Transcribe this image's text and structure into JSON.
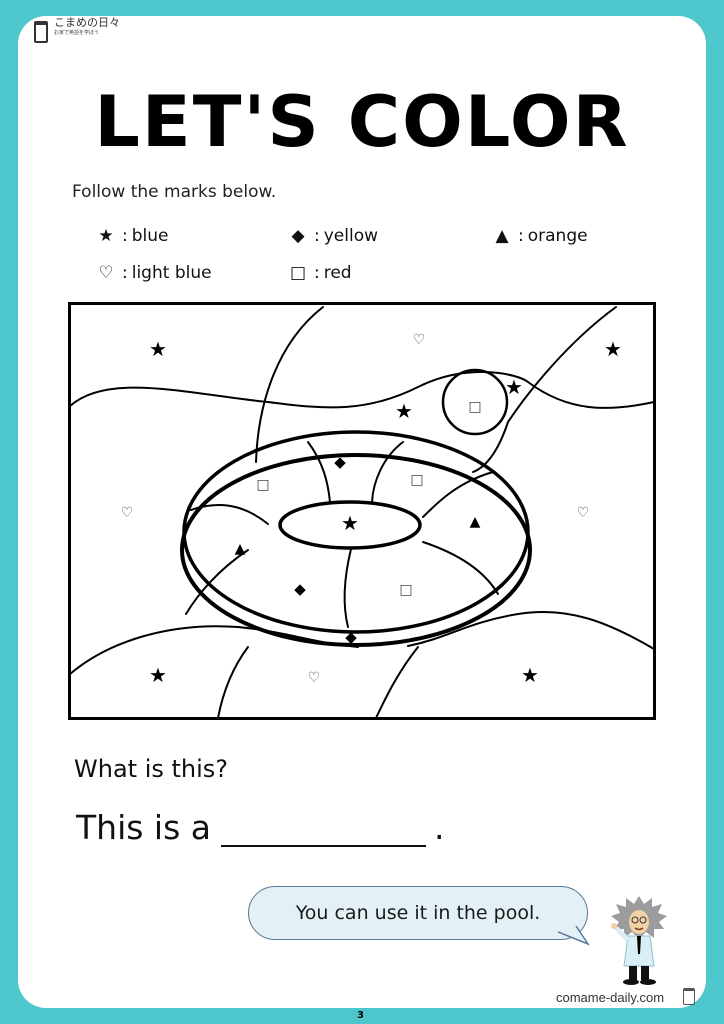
{
  "brand": {
    "name": "こまめの日々",
    "tagline": "お家で英語を学ぼう",
    "icon": "book-icon"
  },
  "title": "LET'S COLOR",
  "instruction": "Follow the marks below.",
  "legend": [
    {
      "symbol": "★",
      "icon": "star-icon",
      "color_name": "blue"
    },
    {
      "symbol": "◆",
      "icon": "diamond-icon",
      "color_name": "yellow"
    },
    {
      "symbol": "▲",
      "icon": "triangle-icon",
      "color_name": "orange"
    },
    {
      "symbol": "♡",
      "icon": "heart-icon",
      "color_name": "light blue"
    },
    {
      "symbol": "□",
      "icon": "square-icon",
      "color_name": "red"
    }
  ],
  "legend_separator": ":",
  "drawing": {
    "subject": "swim ring coloring picture",
    "marks": [
      {
        "symbol": "★"
      },
      {
        "symbol": "♡"
      },
      {
        "symbol": "★"
      },
      {
        "symbol": "★"
      },
      {
        "symbol": "★"
      },
      {
        "symbol": "□"
      },
      {
        "symbol": "◆"
      },
      {
        "symbol": "□"
      },
      {
        "symbol": "□"
      },
      {
        "symbol": "♡"
      },
      {
        "symbol": "★"
      },
      {
        "symbol": "▲"
      },
      {
        "symbol": "♡"
      },
      {
        "symbol": "▲"
      },
      {
        "symbol": "◆"
      },
      {
        "symbol": "□"
      },
      {
        "symbol": "◆"
      },
      {
        "symbol": "★"
      },
      {
        "symbol": "♡"
      },
      {
        "symbol": "★"
      }
    ]
  },
  "question": "What is this?",
  "answer_prefix": "This is a",
  "answer_suffix": ".",
  "hint": "You can use it in the pool.",
  "site": "comame-daily.com",
  "page_number": "3",
  "colors": {
    "frame": "#4dc7cc",
    "bubble_fill": "#e3f1f6",
    "bubble_border": "#5a7a98"
  }
}
